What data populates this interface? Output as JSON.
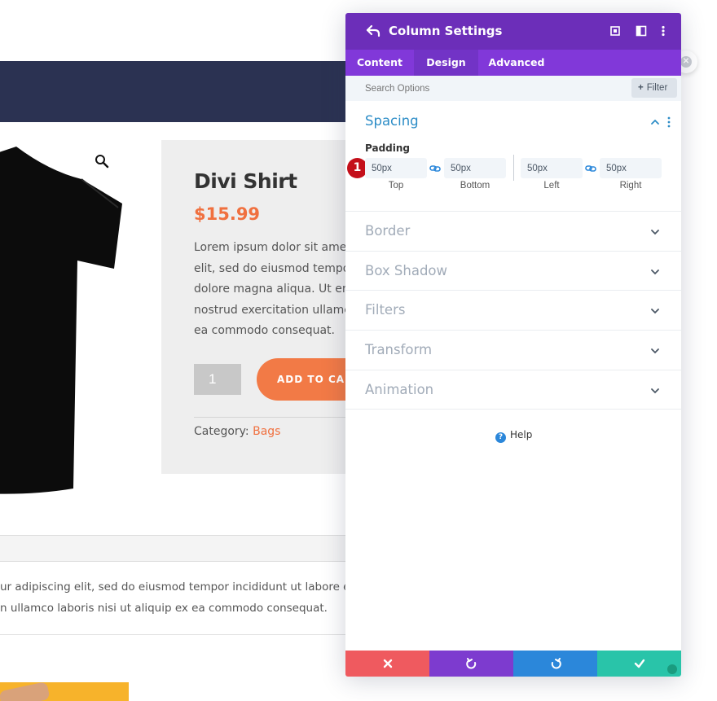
{
  "page": {
    "product_title": "Divi Shirt",
    "product_price": "$15.99",
    "product_description_lines": [
      "Lorem ipsum dolor sit amet, co",
      "elit, sed do eiusmod tempor inc",
      "dolore magna aliqua. Ut enim a",
      "nostrud exercitation ullamco lal",
      "ea commodo consequat."
    ],
    "quantity": "1",
    "add_to_cart": "ADD TO CART",
    "category_label": "Category:",
    "category_value": "Bags",
    "bottom_text_lines": [
      "ur adipiscing elit, sed do eiusmod tempor incididunt ut labore et dolore",
      "n ullamco laboris nisi ut aliquip ex ea commodo consequat."
    ]
  },
  "modal": {
    "title": "Column Settings",
    "tabs": [
      "Content",
      "Design",
      "Advanced"
    ],
    "active_tab": "Design",
    "search_placeholder": "Search Options",
    "filter_label": "Filter",
    "spacing": {
      "title": "Spacing",
      "padding_label": "Padding",
      "step_badge": "1",
      "fields": [
        {
          "label": "Top",
          "value": "50px"
        },
        {
          "label": "Bottom",
          "value": "50px"
        },
        {
          "label": "Left",
          "value": "50px"
        },
        {
          "label": "Right",
          "value": "50px"
        }
      ]
    },
    "groups": [
      "Border",
      "Box Shadow",
      "Filters",
      "Transform",
      "Animation"
    ],
    "help_label": "Help",
    "colors": {
      "header": "#6c2eb9",
      "tabs": "#8138d9",
      "cancel": "#ef5a5f",
      "undo": "#7d3bcf",
      "redo": "#2b87da",
      "save": "#29c4a9",
      "accent_orange": "#f27a46"
    }
  }
}
